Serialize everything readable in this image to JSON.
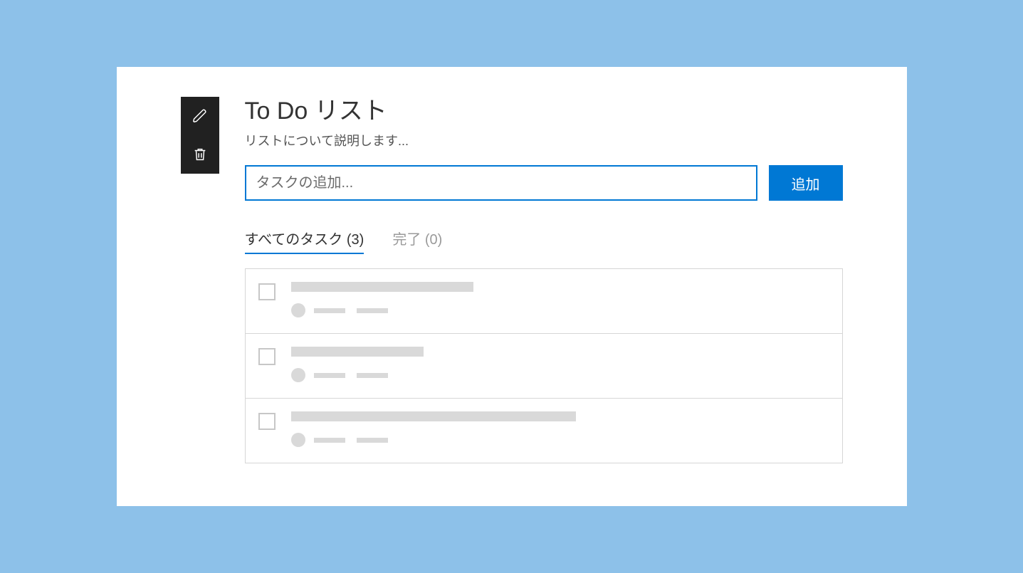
{
  "header": {
    "title": "To Do リスト",
    "subtitle": "リストについて説明します..."
  },
  "actions": {
    "edit_icon": "pencil-icon",
    "delete_icon": "trash-icon"
  },
  "input": {
    "placeholder": "タスクの追加...",
    "add_button_label": "追加"
  },
  "tabs": {
    "all": {
      "label": "すべてのタスク",
      "count": 3
    },
    "done": {
      "label": "完了",
      "count": 0
    }
  },
  "tasks": [
    {
      "title_width": 256,
      "checked": false
    },
    {
      "title_width": 186,
      "checked": false
    },
    {
      "title_width": 400,
      "checked": false
    }
  ]
}
